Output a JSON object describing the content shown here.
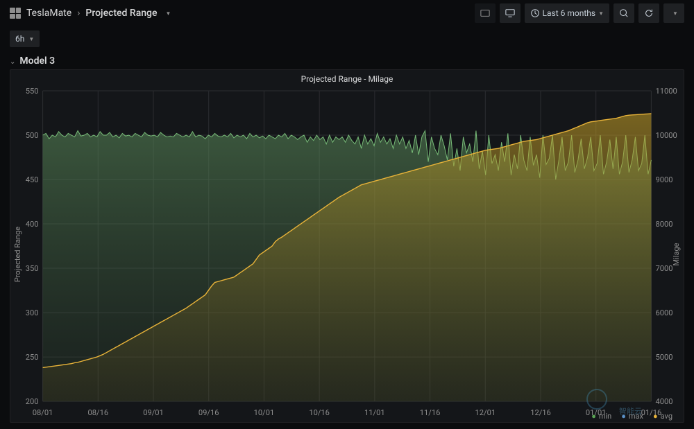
{
  "breadcrumb": {
    "root": "TeslaMate",
    "title": "Projected Range"
  },
  "time_range_label": "Last 6 months",
  "variable_selector": "6h",
  "row_title": "Model 3",
  "panel_title": "Projected Range - Milage",
  "axis_labels": {
    "left": "Projected Range",
    "right": "Milage"
  },
  "legend": {
    "min": "min",
    "max": "max",
    "avg": "avg"
  },
  "chart_data": {
    "type": "area",
    "x_categories": [
      "08/01",
      "08/16",
      "09/01",
      "09/16",
      "10/01",
      "10/16",
      "11/01",
      "11/16",
      "12/01",
      "12/16",
      "01/01",
      "01/16"
    ],
    "y_left": {
      "label": "Projected Range",
      "min": 200,
      "max": 550,
      "ticks": [
        200,
        250,
        300,
        350,
        400,
        450,
        500,
        550
      ]
    },
    "y_right": {
      "label": "Milage",
      "min": 4000,
      "max": 11000,
      "ticks": [
        4000,
        5000,
        6000,
        7000,
        8000,
        9000,
        10000,
        11000
      ]
    },
    "series": [
      {
        "name": "Projected Range",
        "axis": "left",
        "color": "#6fbf73",
        "values": [
          500,
          502,
          496,
          500,
          498,
          504,
          500,
          498,
          502,
          500,
          498,
          505,
          499,
          500,
          502,
          498,
          500,
          498,
          504,
          500,
          500,
          503,
          498,
          500,
          497,
          502,
          499,
          500,
          498,
          502,
          500,
          498,
          503,
          500,
          499,
          500,
          498,
          503,
          500,
          498,
          499,
          498,
          502,
          500,
          498,
          500,
          498,
          504,
          498,
          500,
          499,
          496,
          500,
          498,
          502,
          499,
          498,
          500,
          498,
          502,
          497,
          500,
          498,
          500,
          496,
          502,
          498,
          500,
          497,
          499,
          496,
          500,
          498,
          496,
          500,
          498,
          502,
          496,
          500,
          498,
          495,
          498,
          500,
          492,
          498,
          494,
          500,
          495,
          498,
          490,
          500,
          492,
          498,
          495,
          498,
          492,
          500,
          494,
          490,
          498,
          485,
          500,
          490,
          496,
          488,
          502,
          492,
          498,
          490,
          496,
          485,
          500,
          490,
          498,
          485,
          494,
          480,
          500,
          478,
          498,
          505,
          470,
          498,
          485,
          478,
          500,
          488,
          472,
          502,
          465,
          485,
          460,
          498,
          480,
          490,
          470,
          505,
          462,
          482,
          455,
          500,
          468,
          478,
          460,
          492,
          470,
          502,
          455,
          478,
          462,
          500,
          472,
          460,
          498,
          466,
          478,
          452,
          500,
          467,
          474,
          500,
          450,
          472,
          498,
          460,
          470,
          500,
          458,
          472,
          496,
          462,
          475,
          498,
          460,
          468,
          500,
          456,
          470,
          495,
          462,
          498,
          456,
          470,
          500,
          458,
          472,
          498,
          460,
          468,
          500,
          456,
          472
        ]
      },
      {
        "name": "Milage",
        "axis": "right",
        "color": "#e8b339",
        "values": [
          4760,
          4770,
          4780,
          4790,
          4800,
          4810,
          4820,
          4830,
          4840,
          4850,
          4870,
          4880,
          4900,
          4920,
          4940,
          4960,
          4980,
          5000,
          5030,
          5060,
          5100,
          5140,
          5180,
          5220,
          5260,
          5300,
          5340,
          5380,
          5420,
          5460,
          5500,
          5540,
          5580,
          5620,
          5660,
          5700,
          5740,
          5780,
          5820,
          5860,
          5900,
          5940,
          5980,
          6020,
          6060,
          6100,
          6150,
          6200,
          6250,
          6300,
          6350,
          6400,
          6500,
          6600,
          6680,
          6700,
          6720,
          6740,
          6760,
          6780,
          6800,
          6850,
          6900,
          6950,
          7000,
          7050,
          7100,
          7200,
          7300,
          7350,
          7400,
          7450,
          7500,
          7600,
          7660,
          7700,
          7750,
          7800,
          7850,
          7900,
          7950,
          8000,
          8050,
          8100,
          8150,
          8200,
          8250,
          8300,
          8350,
          8400,
          8450,
          8500,
          8550,
          8600,
          8640,
          8680,
          8720,
          8760,
          8800,
          8840,
          8880,
          8900,
          8920,
          8940,
          8960,
          8980,
          9000,
          9020,
          9040,
          9060,
          9080,
          9100,
          9120,
          9140,
          9160,
          9180,
          9200,
          9220,
          9240,
          9260,
          9280,
          9300,
          9320,
          9340,
          9360,
          9380,
          9400,
          9420,
          9440,
          9460,
          9480,
          9500,
          9520,
          9540,
          9560,
          9580,
          9600,
          9620,
          9640,
          9660,
          9670,
          9680,
          9690,
          9700,
          9720,
          9740,
          9760,
          9780,
          9800,
          9820,
          9840,
          9860,
          9870,
          9880,
          9890,
          9900,
          9920,
          9940,
          9960,
          9980,
          10000,
          10020,
          10040,
          10060,
          10080,
          10100,
          10130,
          10160,
          10190,
          10220,
          10250,
          10280,
          10300,
          10310,
          10320,
          10330,
          10340,
          10350,
          10360,
          10370,
          10380,
          10400,
          10420,
          10440,
          10450,
          10455,
          10460,
          10465,
          10470,
          10475,
          10480,
          10485
        ]
      }
    ]
  }
}
